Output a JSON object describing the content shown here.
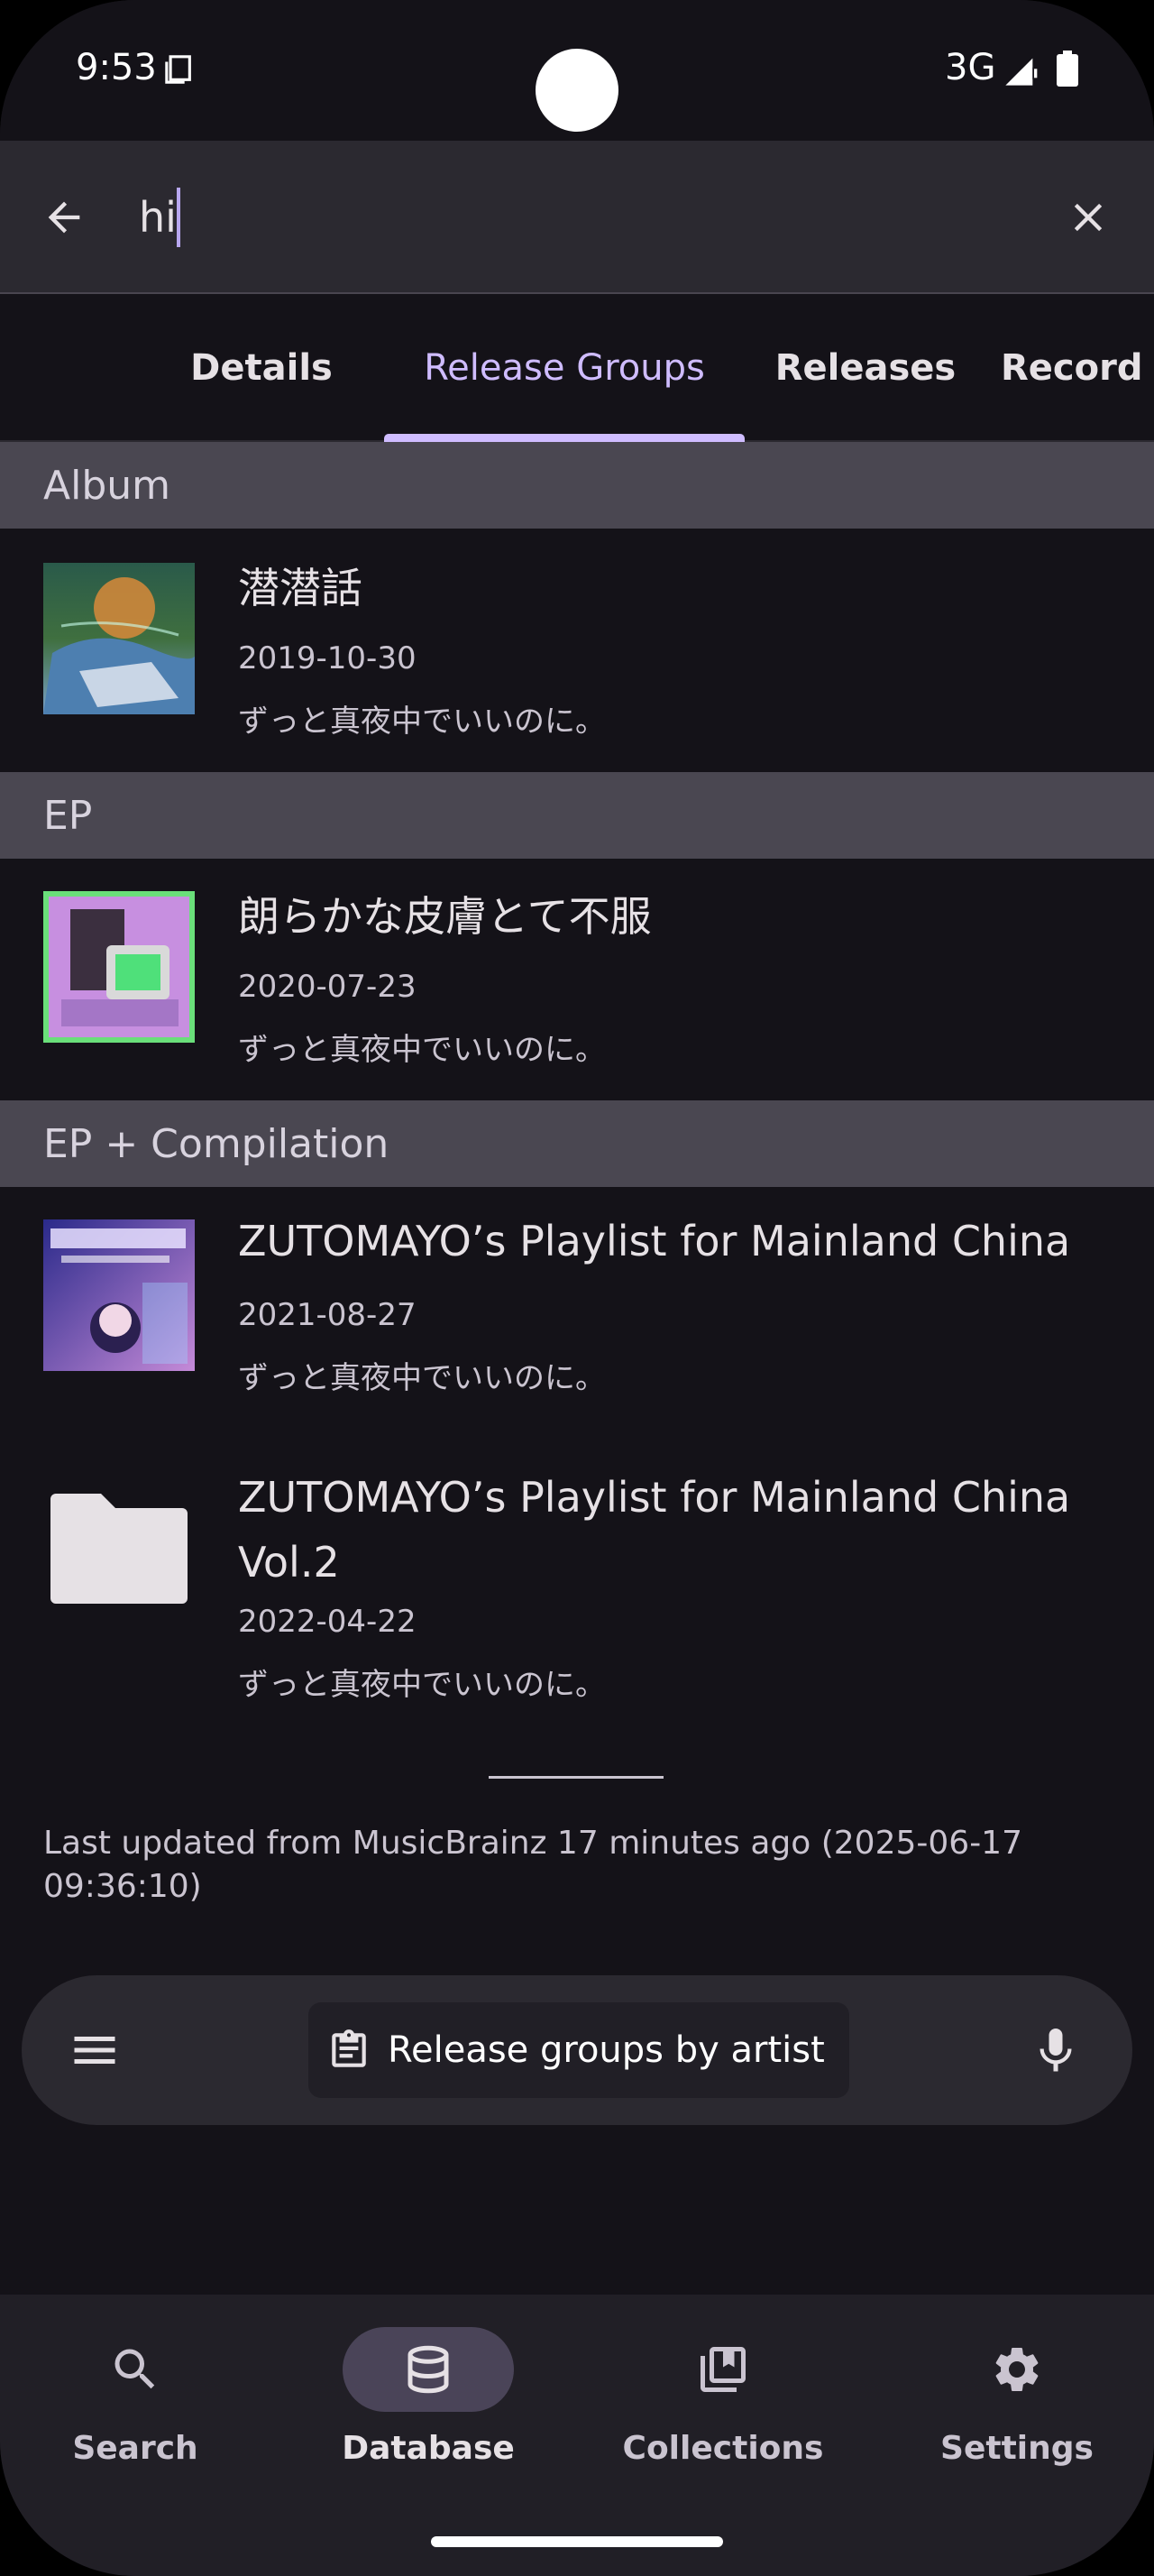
{
  "status_bar": {
    "time": "9:53",
    "network": "3G"
  },
  "search": {
    "value": "hi",
    "placeholder": ""
  },
  "tabs": [
    {
      "label": "Details"
    },
    {
      "label": "Release Groups"
    },
    {
      "label": "Releases"
    },
    {
      "label": "Record"
    }
  ],
  "sections": [
    {
      "header": "Album",
      "items": [
        {
          "title": "潜潜話",
          "date": "2019-10-30",
          "artist": "ずっと真夜中でいいのに。",
          "cover": "album-art"
        }
      ]
    },
    {
      "header": "EP",
      "items": [
        {
          "title": "朗らかな皮膚とて不服",
          "date": "2020-07-23",
          "artist": "ずっと真夜中でいいのに。",
          "cover": "album-art"
        }
      ]
    },
    {
      "header": "EP + Compilation",
      "items": [
        {
          "title": "ZUTOMAYO’s Playlist for Mainland China",
          "date": "2021-08-27",
          "artist": "ずっと真夜中でいいのに。",
          "cover": "album-art"
        },
        {
          "title": "ZUTOMAYO’s Playlist for Mainland China Vol.2",
          "date": "2022-04-22",
          "artist": "ずっと真夜中でいいのに。",
          "cover": "folder-icon"
        }
      ]
    }
  ],
  "footer": {
    "last_updated": "Last updated from MusicBrainz 17 minutes ago (2025-06-17 09:36:10)"
  },
  "bottom_search": {
    "chip_label": "Release groups by artist"
  },
  "nav": [
    {
      "label": "Search",
      "icon": "search-icon"
    },
    {
      "label": "Database",
      "icon": "database-icon",
      "active": true
    },
    {
      "label": "Collections",
      "icon": "collections-icon"
    },
    {
      "label": "Settings",
      "icon": "gear-icon"
    }
  ],
  "colors": {
    "background": "#141218",
    "accent": "#cfbcff",
    "section_header": "#4a4751",
    "surface": "#2b2930"
  }
}
